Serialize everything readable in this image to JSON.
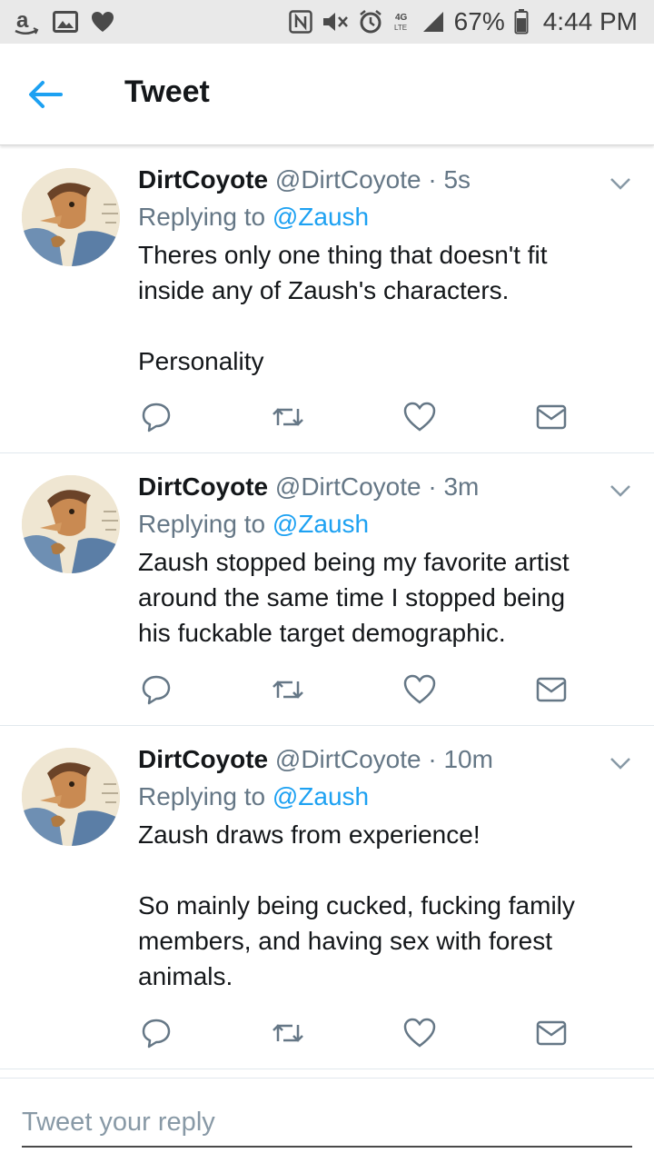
{
  "status_bar": {
    "battery": "67%",
    "time": "4:44 PM",
    "network": "4G LTE"
  },
  "header": {
    "title": "Tweet"
  },
  "tweets": [
    {
      "name": "DirtCoyote",
      "handle": "@DirtCoyote",
      "separator": "·",
      "time": "5s",
      "replying_prefix": "Replying to",
      "replying_handle": "@Zaush",
      "text": "Theres only one thing that doesn't fit\ninside any of Zaush's characters.\n\nPersonality"
    },
    {
      "name": "DirtCoyote",
      "handle": "@DirtCoyote",
      "separator": "·",
      "time": "3m",
      "replying_prefix": "Replying to",
      "replying_handle": "@Zaush",
      "text": "Zaush stopped being my favorite artist\naround the same time I stopped being\nhis fuckable target demographic."
    },
    {
      "name": "DirtCoyote",
      "handle": "@DirtCoyote",
      "separator": "·",
      "time": "10m",
      "replying_prefix": "Replying to",
      "replying_handle": "@Zaush",
      "text": "Zaush draws from experience!\n\nSo mainly being cucked, fucking family\nmembers, and having sex with forest\nanimals."
    }
  ],
  "composer": {
    "placeholder": "Tweet your reply"
  },
  "icons": {
    "accent": "#1da1f2",
    "action_color": "#657786"
  }
}
